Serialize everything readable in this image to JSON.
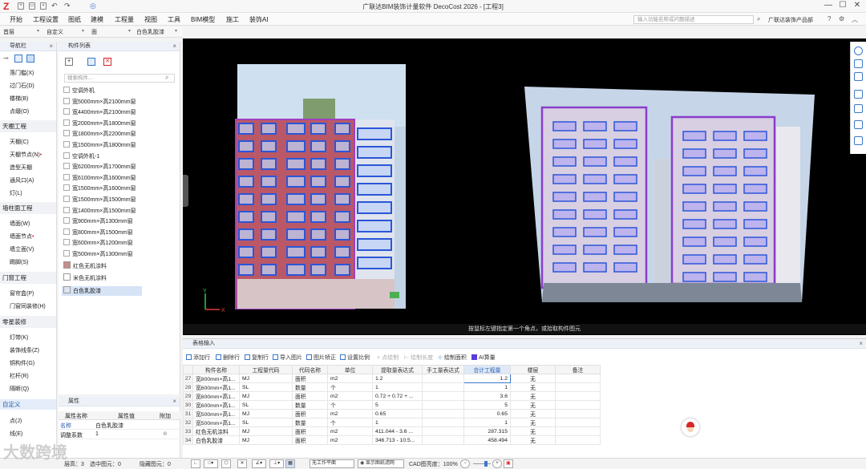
{
  "app": {
    "title": "广联达BIM装饰计量软件 DecoCost 2026 - [工程3]",
    "search_placeholder": "输入功能名称或问题描述",
    "brand_link": "广联达装饰产品部",
    "menus": [
      "开始",
      "工程设置",
      "图纸",
      "建模",
      "工程量",
      "视图",
      "工具",
      "BIM模型",
      "施工",
      "装饰AI"
    ]
  },
  "selectors": {
    "floor": "首层",
    "custom": "自定义",
    "face": "面",
    "material": "白色乳胶漆"
  },
  "nav": {
    "title": "导航栏",
    "items_top": [
      "落门槛(X)",
      "过门石(D)",
      "楼梯(B)",
      "点缀(O)"
    ],
    "group_ceiling": "天棚工程",
    "ceiling_items": [
      "天棚(C)",
      "天棚节点(N)",
      "造型天棚",
      "通风口(A)",
      "灯(L)"
    ],
    "group_wall": "墙柱面工程",
    "wall_items": [
      "墙面(W)",
      "墙面节点",
      "墙立面(V)",
      "踢脚(S)"
    ],
    "group_door": "门窗工程",
    "door_items": [
      "窗帘盒(P)",
      "门窗同装修(H)"
    ],
    "group_misc": "零星装修",
    "misc_items": [
      "灯带(K)",
      "装饰线条(Z)",
      "铜构件(G)",
      "栏杆(R)",
      "隔断(Q)"
    ],
    "group_custom": "自定义",
    "custom_items": [
      "点(J)",
      "线(E)"
    ]
  },
  "components": {
    "title": "构件列表",
    "search_placeholder": "搜索构件...",
    "items": [
      "空调外机",
      "宽5000mm×高2100mm窗",
      "宽4400mm×高2100mm窗",
      "宽2000mm×高1800mm窗",
      "宽1800mm×高2200mm窗",
      "宽1500mm×高1800mm窗",
      "空调外机-1",
      "宽6200mm×高1700mm窗",
      "宽6100mm×高1600mm窗",
      "宽1500mm×高1600mm窗",
      "宽1500mm×高1500mm窗",
      "宽1400mm×高1500mm窗",
      "宽900mm×高1300mm窗",
      "宽800mm×高1500mm窗",
      "宽600mm×高1200mm窗",
      "宽500mm×高1300mm窗"
    ],
    "materials": [
      {
        "name": "红色无机涂料",
        "color": "#c98b8b"
      },
      {
        "name": "米色无机涂料",
        "color": "#ffffff"
      },
      {
        "name": "白色乳胶漆",
        "color": "#dde6f4"
      }
    ]
  },
  "properties": {
    "title": "属性",
    "headers": [
      "属性名称",
      "属性值",
      "附加"
    ],
    "rows": [
      [
        "名称",
        "白色乳胶漆"
      ],
      [
        "调整系数",
        "1"
      ]
    ]
  },
  "viewport": {
    "status": "按鼠标左键指定第一个角点，或拾取构件图元"
  },
  "table": {
    "title": "表格输入",
    "toolbar": [
      "添加行",
      "删除行",
      "复制行",
      "导入图片",
      "图片矫正",
      "设置比例",
      "点绘制",
      "绘制长度",
      "绘制面积",
      "AI算量"
    ],
    "headers": [
      "构件名称",
      "工程量代码",
      "代码名称",
      "单位",
      "提取量表达式",
      "手工量表达式",
      "合计工程量",
      "楼层",
      "备注"
    ],
    "rows": [
      {
        "n": "27",
        "name": "宽800mm×高1...",
        "code": "MJ",
        "cname": "面积",
        "unit": "m2",
        "expr": "1.2",
        "manual": "",
        "total": "1.2",
        "floor": "无"
      },
      {
        "n": "28",
        "name": "宽600mm×高1...",
        "code": "SL",
        "cname": "数量",
        "unit": "个",
        "expr": "1",
        "manual": "",
        "total": "1",
        "floor": "无"
      },
      {
        "n": "29",
        "name": "宽600mm×高1...",
        "code": "MJ",
        "cname": "面积",
        "unit": "m2",
        "expr": "0.72 + 0.72 + ...",
        "manual": "",
        "total": "3.6",
        "floor": "无"
      },
      {
        "n": "30",
        "name": "宽600mm×高1...",
        "code": "SL",
        "cname": "数量",
        "unit": "个",
        "expr": "5",
        "manual": "",
        "total": "5",
        "floor": "无"
      },
      {
        "n": "31",
        "name": "宽500mm×高1...",
        "code": "MJ",
        "cname": "面积",
        "unit": "m2",
        "expr": "0.65",
        "manual": "",
        "total": "0.65",
        "floor": "无"
      },
      {
        "n": "32",
        "name": "宽500mm×高1...",
        "code": "SL",
        "cname": "数量",
        "unit": "个",
        "expr": "1",
        "manual": "",
        "total": "1",
        "floor": "无"
      },
      {
        "n": "33",
        "name": "红色无机涂料",
        "code": "MJ",
        "cname": "面积",
        "unit": "m2",
        "expr": "411.044 - 3.6 ...",
        "manual": "",
        "total": "287.315",
        "floor": "无"
      },
      {
        "n": "34",
        "name": "白色乳胶漆",
        "code": "MJ",
        "cname": "面积",
        "unit": "m2",
        "expr": "346.713 - 10.5...",
        "manual": "",
        "total": "458.494",
        "floor": "无"
      }
    ]
  },
  "statusbar": {
    "floor": "层高：3",
    "selected": "选中图元：0",
    "hidden": "隐藏图元：0",
    "plane": "无工作平面",
    "display": "显示图纸滤网",
    "cad": "CAD图亮度：100%"
  },
  "watermark": "大数跨境"
}
